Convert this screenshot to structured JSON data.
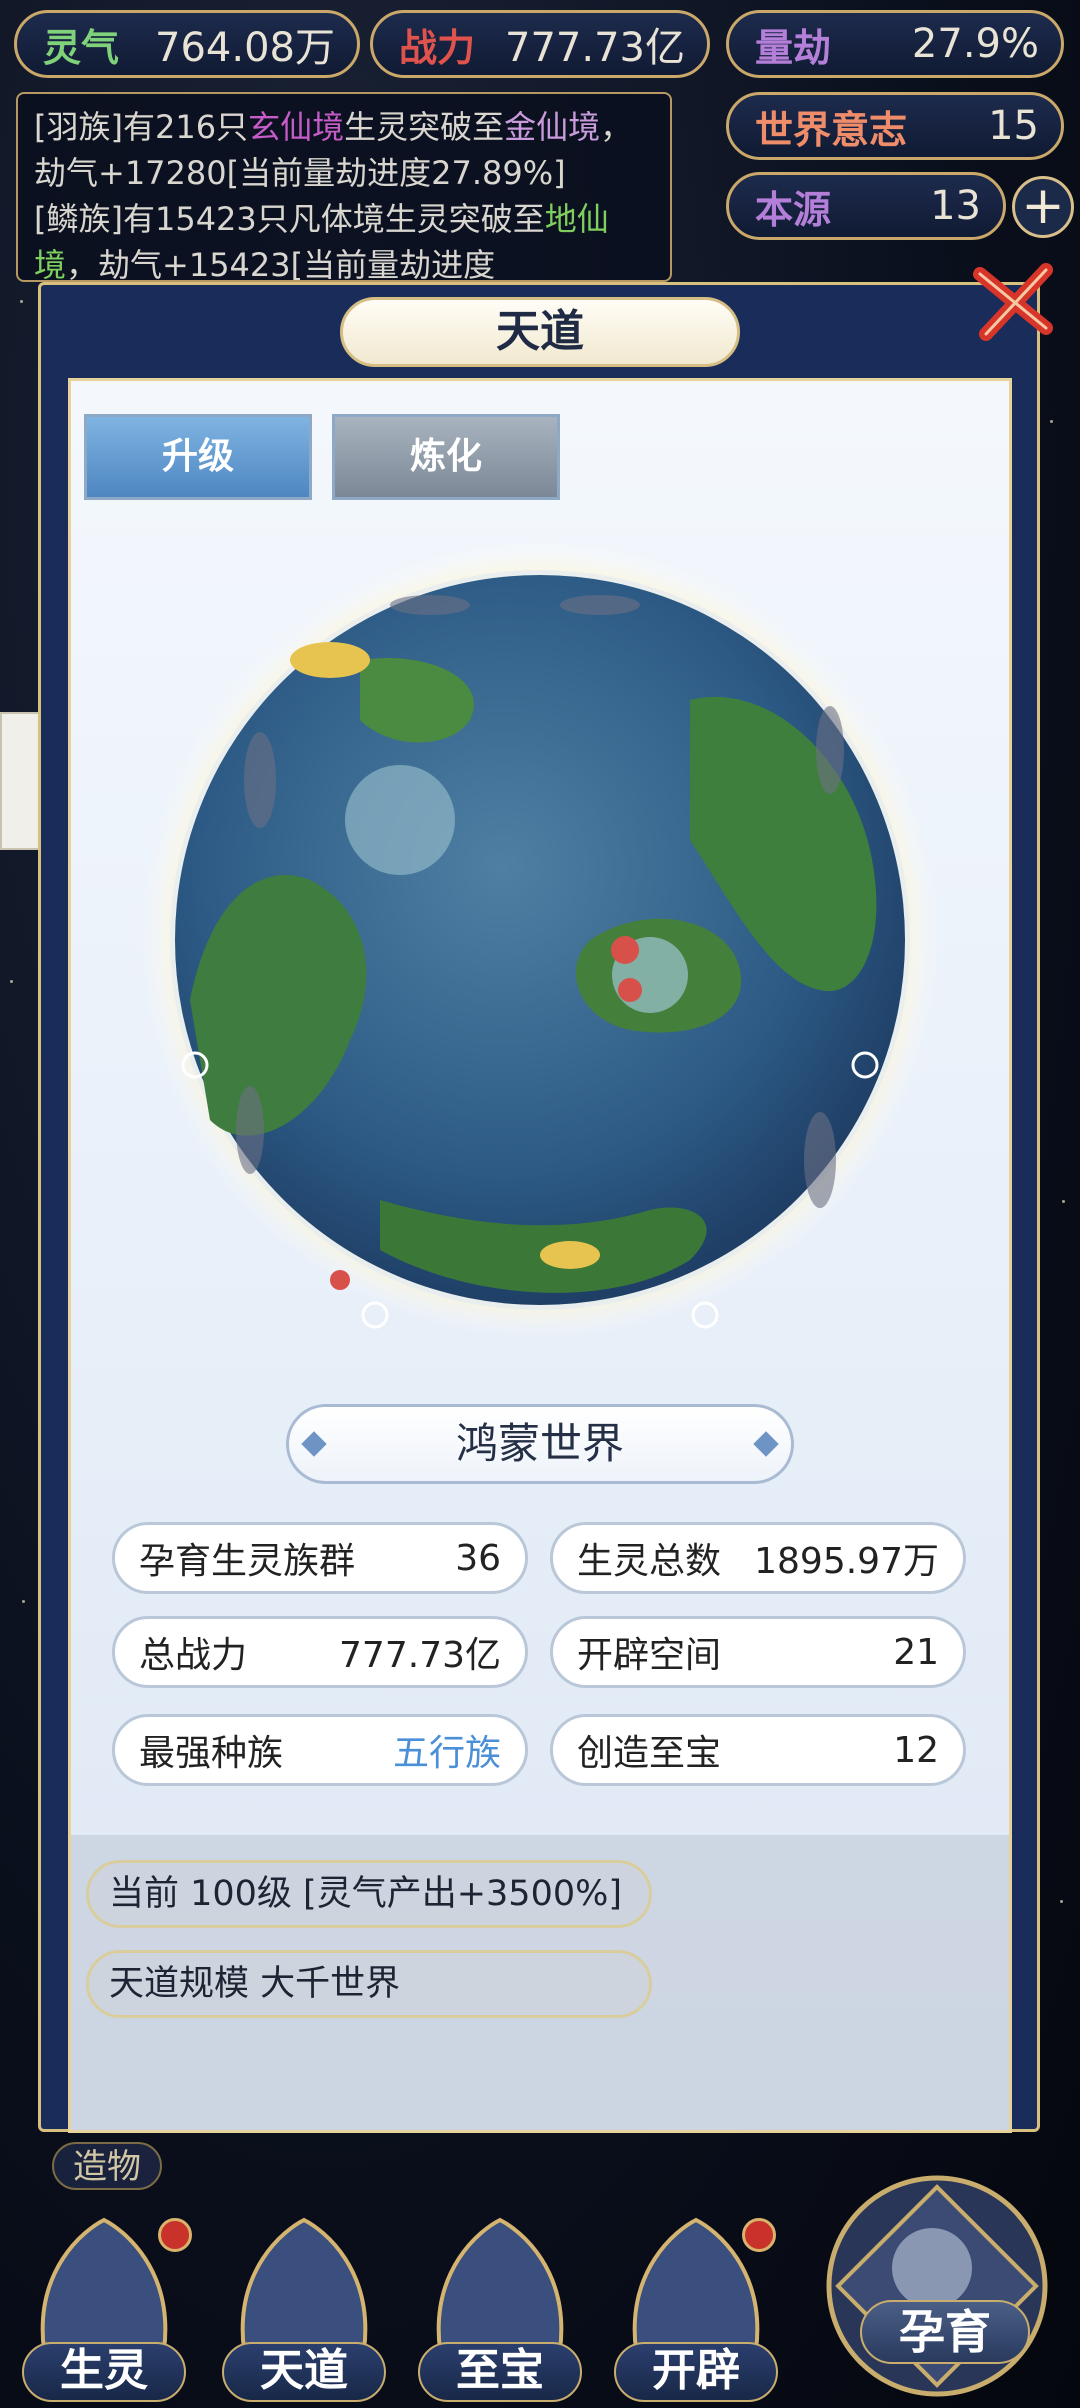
{
  "resources": {
    "lingqi": {
      "label": "灵气",
      "value": "764.08万"
    },
    "zhanli": {
      "label": "战力",
      "value": "777.73亿"
    },
    "liangjie": {
      "label": "量劫",
      "value": "27.9%"
    },
    "shijie_yizhi": {
      "label": "世界意志",
      "value": "15"
    },
    "benyuan": {
      "label": "本源",
      "value": "13"
    }
  },
  "log": [
    {
      "a": "[羽族]有216只",
      "b": "玄仙境",
      "c": "生灵突破至",
      "d": "金仙境",
      "e": "，劫气+17280[当前量劫进度27.89%]"
    },
    {
      "a": "[鳞族]有15423只凡体境生灵突破至",
      "b": "地仙境",
      "c": "，劫气+15423[当前量劫进度",
      "d": "",
      "e": ""
    }
  ],
  "panel": {
    "title": "天道",
    "tabs": [
      "升级",
      "炼化"
    ],
    "world_name": "鸿蒙世界",
    "stats": [
      {
        "label": "孕育生灵族群",
        "value": "36"
      },
      {
        "label": "生灵总数",
        "value": "1895.97万"
      },
      {
        "label": "总战力",
        "value": "777.73亿"
      },
      {
        "label": "开辟空间",
        "value": "21"
      },
      {
        "label": "最强种族",
        "value": "五行族"
      },
      {
        "label": "创造至宝",
        "value": "12"
      }
    ],
    "level_info": "当前 100级 [灵气产出+3500%]",
    "scale_info": "天道规模 大千世界"
  },
  "side_label": "造物",
  "nav": [
    "生灵",
    "天道",
    "至宝",
    "开辟"
  ],
  "big_button": "孕育",
  "colors": {
    "accent": "#c9a86a",
    "panel_bg": "#f4f8fd",
    "highlight_blue": "#4b8fd8"
  }
}
